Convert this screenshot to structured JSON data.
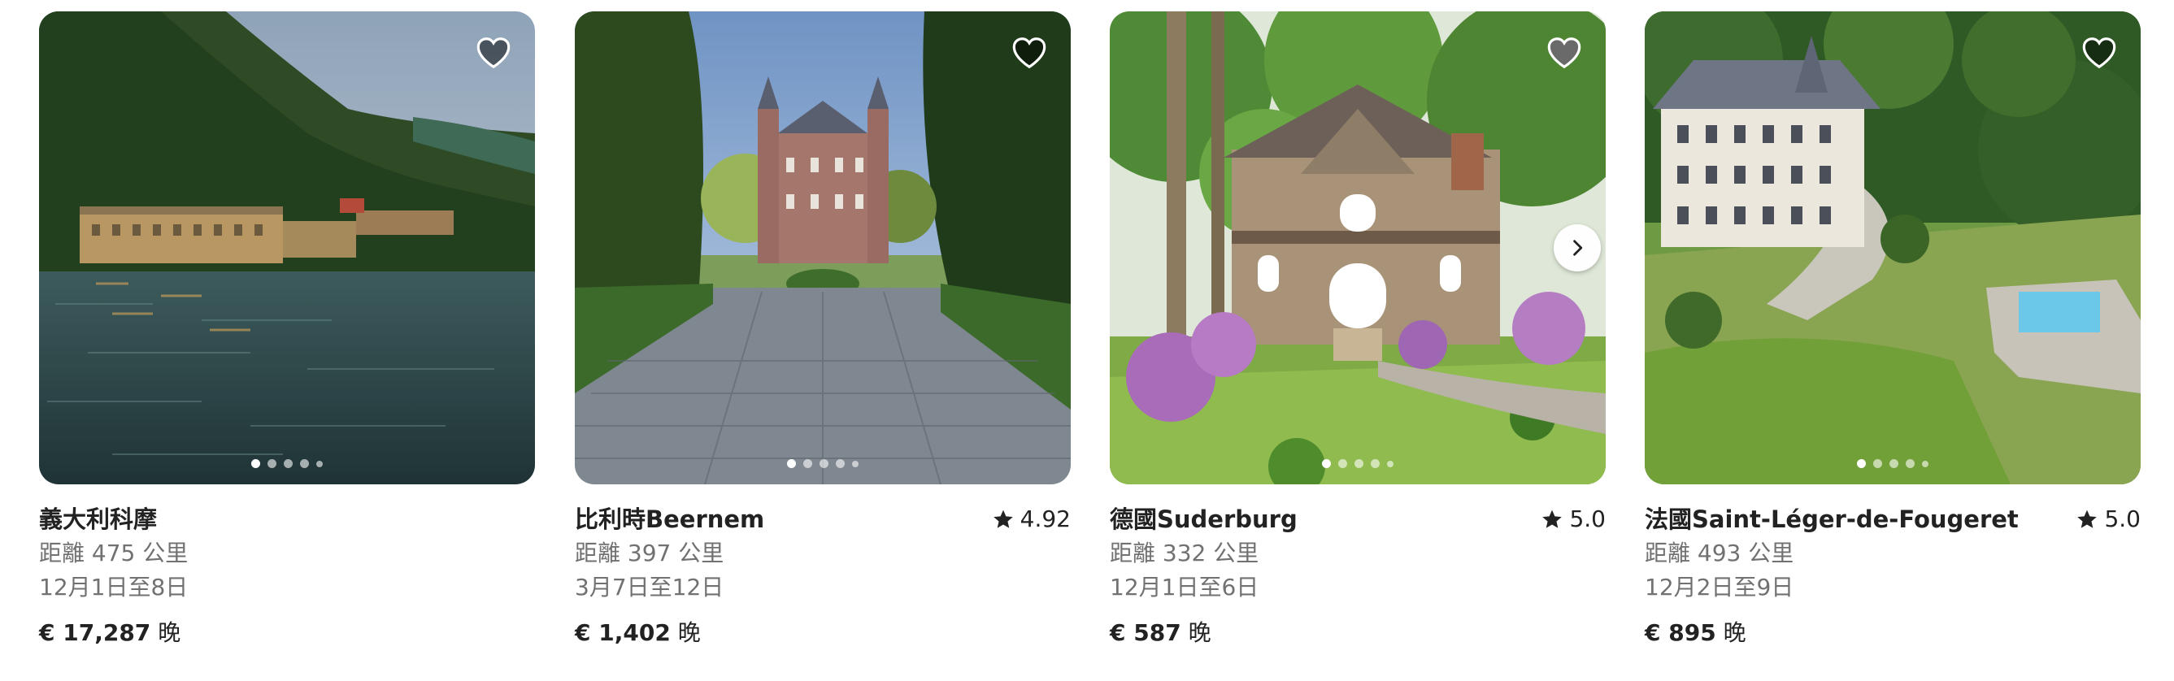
{
  "listings": [
    {
      "title": "義大利科摩",
      "rating": "",
      "distance": "距離 475 公里",
      "dates": "12月1日至8日",
      "price": "€ 17,287",
      "price_unit": "晚",
      "photo_icon": "lake-villa-photo",
      "favorite_icon": "heart-icon",
      "favorited": false,
      "carousel_active": 1,
      "show_next_arrow": false
    },
    {
      "title": "比利時Beernem",
      "rating": "4.92",
      "distance": "距離 397 公里",
      "dates": "3月7日至12日",
      "price": "€ 1,402",
      "price_unit": "晚",
      "photo_icon": "castle-photo",
      "favorite_icon": "heart-icon",
      "favorited": false,
      "carousel_active": 1,
      "show_next_arrow": false
    },
    {
      "title": "德國Suderburg",
      "rating": "5.0",
      "distance": "距離 332 公里",
      "dates": "12月1日至6日",
      "price": "€ 587",
      "price_unit": "晚",
      "photo_icon": "stone-house-photo",
      "favorite_icon": "heart-icon",
      "favorited": true,
      "carousel_active": 1,
      "show_next_arrow": true
    },
    {
      "title": "法國Saint-Léger-de-Fougeret",
      "rating": "5.0",
      "distance": "距離 493 公里",
      "dates": "12月2日至9日",
      "price": "€ 895",
      "price_unit": "晚",
      "photo_icon": "chateau-aerial-photo",
      "favorite_icon": "heart-icon",
      "favorited": false,
      "carousel_active": 1,
      "show_next_arrow": false
    }
  ],
  "icons": {
    "favorite": "heart-icon",
    "rating": "star-icon",
    "next": "chevron-right-icon"
  },
  "colors": {
    "text_primary": "#222222",
    "text_secondary": "#717171",
    "heart_fill_inactive": "rgba(0,0,0,0.5)",
    "heart_fill_active": "#6a6a6a",
    "heart_stroke": "#ffffff"
  }
}
